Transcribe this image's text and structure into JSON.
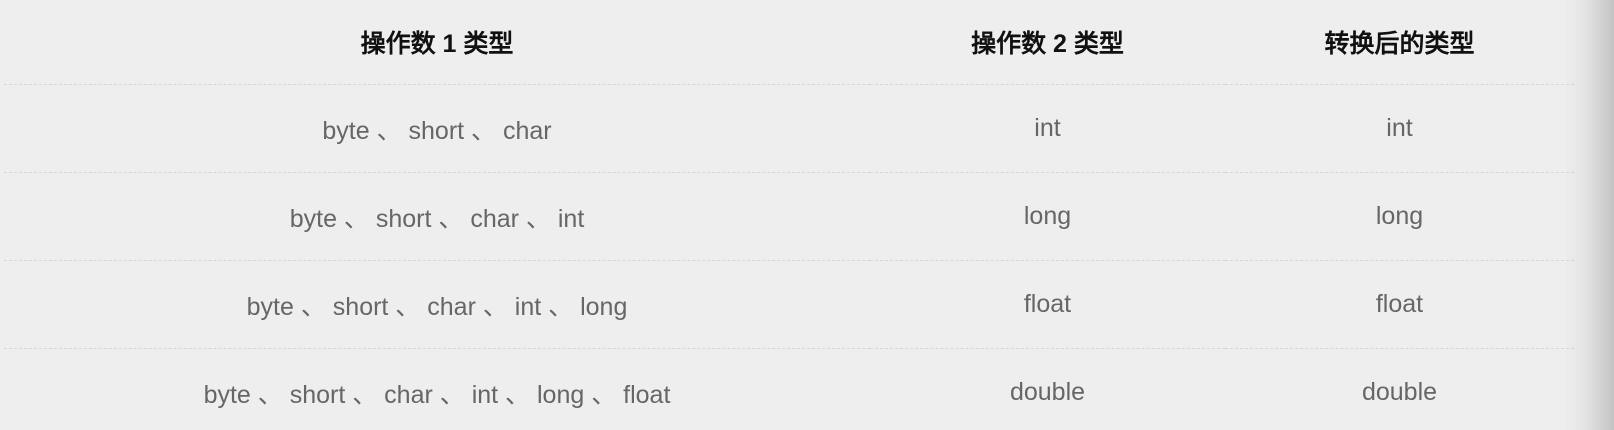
{
  "table": {
    "headers": [
      "操作数 1 类型",
      "操作数 2 类型",
      "转换后的类型"
    ],
    "rows": [
      [
        "byte 、 short 、 char",
        "int",
        "int"
      ],
      [
        "byte 、 short 、 char 、 int",
        "long",
        "long"
      ],
      [
        "byte 、 short 、 char 、 int 、 long",
        "float",
        "float"
      ],
      [
        "byte 、 short 、 char 、 int 、 long 、 float",
        "double",
        "double"
      ]
    ]
  },
  "colors": {
    "background": "#eeeeee",
    "header_text": "#111111",
    "cell_text": "#666666",
    "row_divider": "#d6d6d6"
  }
}
